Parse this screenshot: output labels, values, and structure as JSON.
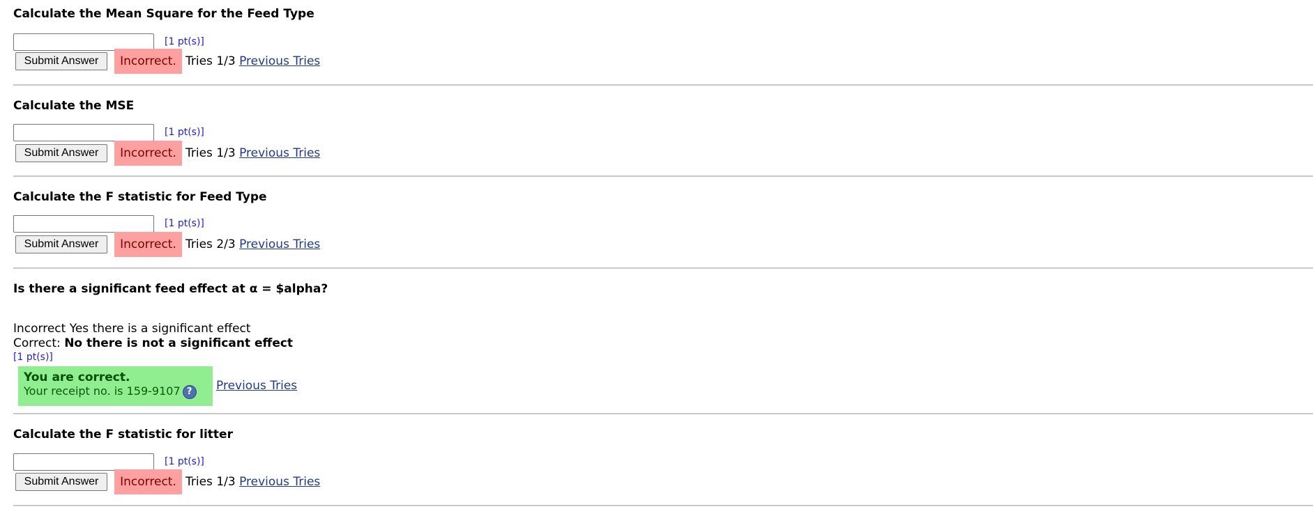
{
  "problems": [
    {
      "title": "Calculate the Mean Square for the Feed Type",
      "points": "[1 pt(s)]",
      "submit_label": "Submit Answer",
      "status": "Incorrect.",
      "tries": "Tries 1/3",
      "previous_tries": "Previous Tries"
    },
    {
      "title": "Calculate the MSE",
      "points": "[1 pt(s)]",
      "submit_label": "Submit Answer",
      "status": "Incorrect.",
      "tries": "Tries 1/3",
      "previous_tries": "Previous Tries"
    },
    {
      "title": "Calculate the F statistic for Feed Type",
      "points": "[1 pt(s)]",
      "submit_label": "Submit Answer",
      "status": "Incorrect.",
      "tries": "Tries 2/3",
      "previous_tries": "Previous Tries"
    },
    {
      "title": "Is there a significant feed effect at α = $alpha?",
      "incorrect_line": "Incorrect Yes there is a significant effect",
      "correct_prefix": "Correct:",
      "correct_answer": "No there is not a significant effect",
      "points": "[1 pt(s)]",
      "status_title": "You are correct.",
      "receipt": "Your receipt no. is 159-9107",
      "help_icon": "?",
      "previous_tries": "Previous Tries"
    },
    {
      "title": "Calculate the F statistic for litter",
      "points": "[1 pt(s)]",
      "submit_label": "Submit Answer",
      "status": "Incorrect.",
      "tries": "Tries 1/3",
      "previous_tries": "Previous Tries"
    }
  ],
  "colors": {
    "incorrect_bg": "#ffa0a0",
    "correct_bg": "#90ee90",
    "link": "#1f3a93",
    "points": "#1a1aff"
  }
}
